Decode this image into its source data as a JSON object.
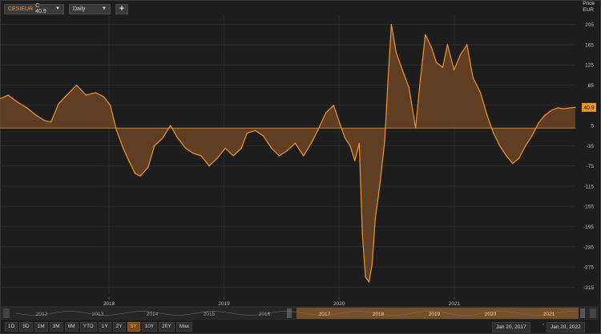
{
  "toolbar": {
    "ric": "CESIEUR",
    "close_text": "C 40.9",
    "frequency": "Daily",
    "add_label": "+"
  },
  "axis_head": {
    "line1": "Price",
    "line2": "EUR"
  },
  "last_value_label": "40.9",
  "colors": {
    "line": "#f2952c",
    "fill": "#6b4424",
    "background": "#1d1d1d",
    "grid": "#333333",
    "accent": "#f09a3c"
  },
  "chart_data": {
    "type": "area",
    "title": "",
    "xlabel": "",
    "ylabel": "Price EUR",
    "ylim": [
      -335,
      225
    ],
    "yticks": [
      -315,
      -275,
      -235,
      -195,
      -155,
      -115,
      -75,
      -35,
      5,
      45,
      85,
      125,
      165,
      205
    ],
    "xlim": [
      "2017-01-20",
      "2022-01-20"
    ],
    "xticks": [
      {
        "x": "2017-01-01",
        "label": "2017"
      },
      {
        "x": "2018-01-01",
        "label": "2018"
      },
      {
        "x": "2019-01-01",
        "label": "2019"
      },
      {
        "x": "2020-01-01",
        "label": "2020"
      },
      {
        "x": "2021-01-01",
        "label": "2021"
      }
    ],
    "baseline": 0,
    "grid": true,
    "series": [
      {
        "x": [
          "2017-01-20",
          "2017-02-15",
          "2017-03-15",
          "2017-04-15",
          "2017-05-15",
          "2017-06-10",
          "2017-07-01",
          "2017-07-25",
          "2017-08-20",
          "2017-09-20",
          "2017-10-20",
          "2017-11-20",
          "2017-12-15",
          "2018-01-05",
          "2018-01-25",
          "2018-02-15",
          "2018-03-05",
          "2018-03-25",
          "2018-04-10",
          "2018-05-05",
          "2018-05-25",
          "2018-06-20",
          "2018-07-15",
          "2018-08-05",
          "2018-09-01",
          "2018-09-25",
          "2018-10-20",
          "2018-11-15",
          "2018-12-10",
          "2019-01-05",
          "2019-01-30",
          "2019-02-25",
          "2019-03-15",
          "2019-04-10",
          "2019-05-05",
          "2019-06-01",
          "2019-06-25",
          "2019-07-20",
          "2019-08-15",
          "2019-09-10",
          "2019-10-05",
          "2019-10-25",
          "2019-11-20",
          "2019-12-15",
          "2019-12-31",
          "2020-01-20",
          "2020-02-05",
          "2020-02-20",
          "2020-03-05",
          "2020-03-15",
          "2020-03-25",
          "2020-04-05",
          "2020-04-15",
          "2020-04-25",
          "2020-05-10",
          "2020-05-25",
          "2020-06-05",
          "2020-06-15",
          "2020-06-30",
          "2020-07-20",
          "2020-08-10",
          "2020-08-31",
          "2020-09-15",
          "2020-10-01",
          "2020-10-20",
          "2020-11-05",
          "2020-11-25",
          "2020-12-10",
          "2020-12-31",
          "2021-01-20",
          "2021-02-10",
          "2021-03-01",
          "2021-03-25",
          "2021-04-15",
          "2021-05-05",
          "2021-05-25",
          "2021-06-15",
          "2021-07-05",
          "2021-07-25",
          "2021-08-15",
          "2021-09-05",
          "2021-09-25",
          "2021-10-15",
          "2021-11-05",
          "2021-11-25",
          "2021-12-15",
          "2022-01-05",
          "2022-01-20"
        ],
        "values": [
          58,
          65,
          52,
          40,
          25,
          15,
          12,
          48,
          65,
          85,
          65,
          70,
          62,
          45,
          -5,
          -40,
          -65,
          -90,
          -95,
          -78,
          -35,
          -20,
          5,
          -18,
          -40,
          -50,
          -55,
          -75,
          -60,
          -40,
          -55,
          -40,
          -10,
          -5,
          -15,
          -40,
          -55,
          -45,
          -30,
          -55,
          -30,
          -5,
          30,
          45,
          15,
          -20,
          -35,
          -65,
          -30,
          -210,
          -295,
          -305,
          -270,
          -180,
          -110,
          -25,
          100,
          205,
          150,
          115,
          80,
          0,
          95,
          185,
          160,
          130,
          120,
          165,
          115,
          145,
          165,
          100,
          70,
          25,
          -10,
          -35,
          -55,
          -70,
          -60,
          -35,
          -15,
          10,
          25,
          35,
          40,
          38,
          40,
          40.9
        ]
      }
    ]
  },
  "navigator": {
    "years": [
      "2012",
      "2013",
      "2014",
      "2015",
      "2016",
      "2017",
      "2018",
      "2019",
      "2020",
      "2021"
    ]
  },
  "ranges": [
    "1D",
    "5D",
    "1M",
    "3M",
    "6M",
    "YTD",
    "1Y",
    "2Y",
    "5Y",
    "10Y",
    "20Y",
    "Max"
  ],
  "active_range": "5Y",
  "date_from": "Jan 20, 2017",
  "date_to": "Jan 20, 2022",
  "date_sep": "-"
}
